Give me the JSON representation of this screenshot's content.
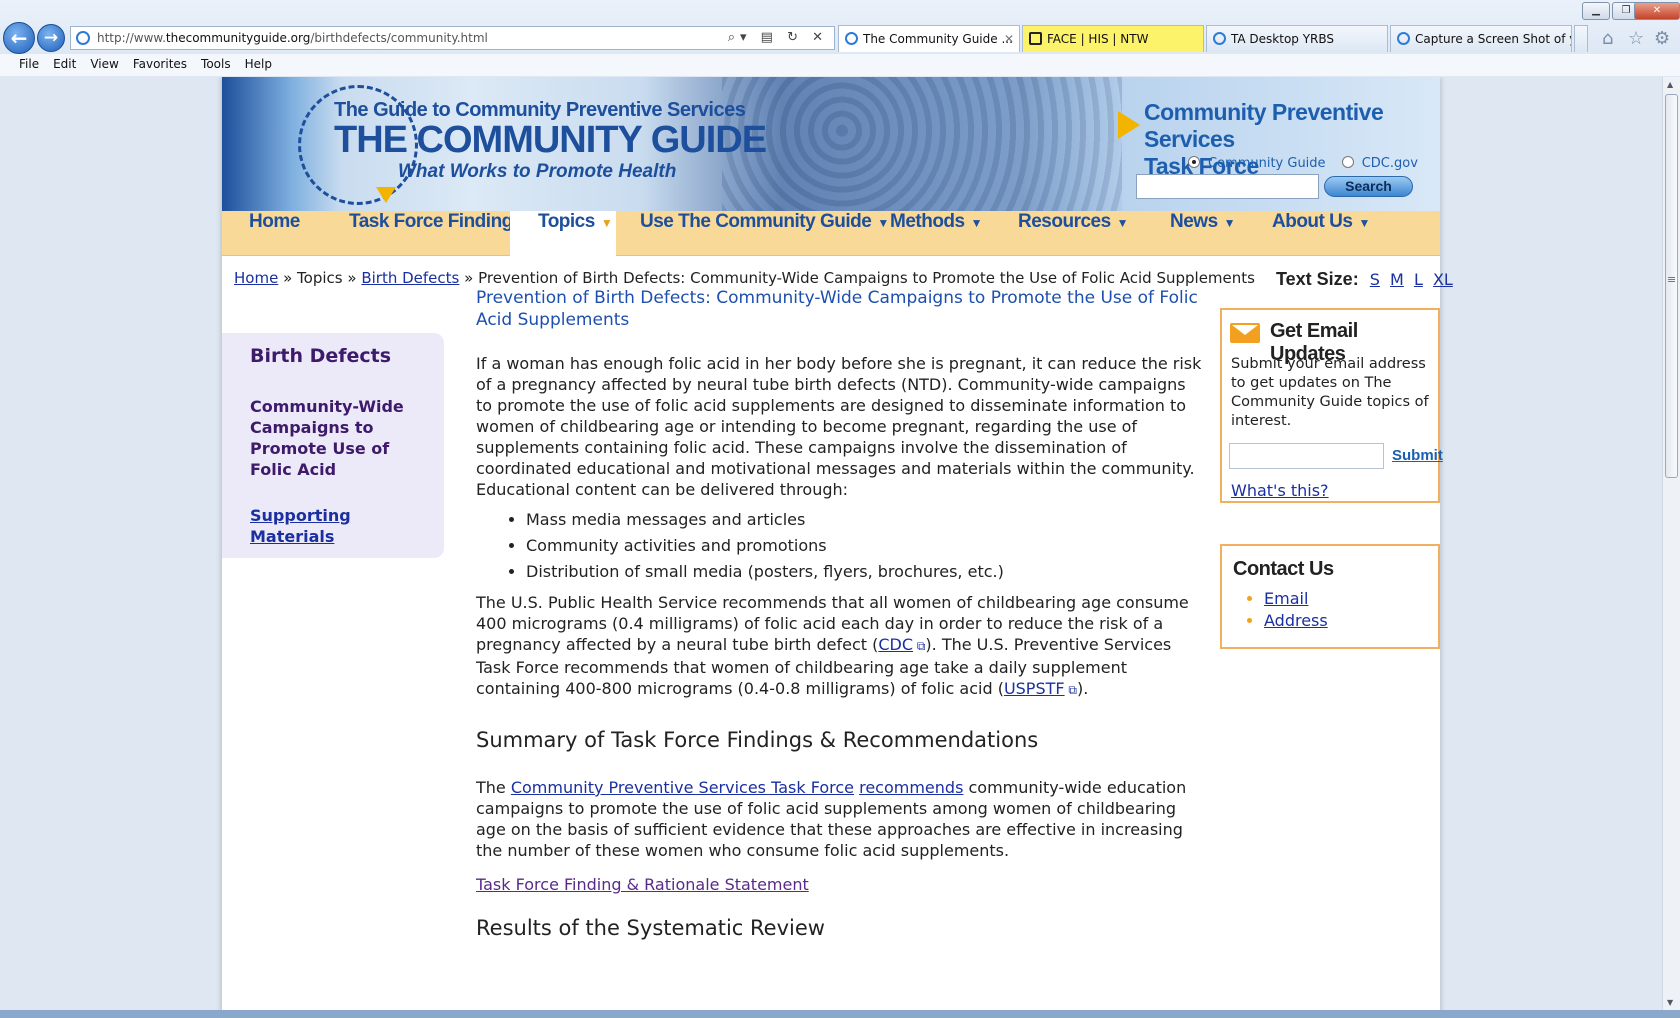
{
  "browser": {
    "address_prefix": "http://www.",
    "address_domain": "thecommunityguide.org",
    "address_path": "/birthdefects/community.html",
    "tabs": [
      {
        "label": "The Community Guide ..."
      },
      {
        "label": "FACE | HIS | NTW"
      },
      {
        "label": "TA Desktop YRBS"
      },
      {
        "label": "Capture a Screen Shot of y..."
      }
    ],
    "menu": [
      "File",
      "Edit",
      "View",
      "Favorites",
      "Tools",
      "Help"
    ]
  },
  "banner": {
    "logo_subtitle": "The Guide to Community Preventive Services",
    "logo_title": "THE COMMUNITY GUIDE",
    "logo_tagline": "What Works to Promote Health",
    "task_force_line1": "Community Preventive Services",
    "task_force_line2": "Task Force",
    "radio_community": "Community Guide",
    "radio_cdc": "CDC.gov",
    "search_button": "Search"
  },
  "nav": [
    {
      "label": "Home"
    },
    {
      "label": "Task Force Findings"
    },
    {
      "label": "Topics"
    },
    {
      "label": "Use The Community Guide"
    },
    {
      "label": "Methods"
    },
    {
      "label": "Resources"
    },
    {
      "label": "News"
    },
    {
      "label": "About Us"
    }
  ],
  "breadcrumb": {
    "home": "Home",
    "sep": "»",
    "topics": "Topics",
    "birth_defects": "Birth Defects",
    "current": "Prevention of Birth Defects: Community-Wide Campaigns to Promote the Use of Folic Acid Supplements"
  },
  "text_size": {
    "label": "Text Size:",
    "s": "S",
    "m": "M",
    "l": "L",
    "xl": "XL"
  },
  "sidebar": {
    "heading": "Birth Defects",
    "current": "Community-Wide Campaigns to Promote Use of Folic Acid",
    "link": "Supporting Materials"
  },
  "content": {
    "title": "Prevention of Birth Defects: Community-Wide Campaigns to Promote the Use of Folic Acid Supplements",
    "intro": "If a woman has enough folic acid in her body before she is pregnant, it can reduce the risk of a pregnancy affected by neural tube birth defects (NTD). Community-wide campaigns to promote the use of folic acid supplements are designed to disseminate information to women of childbearing age or intending to become pregnant, regarding the use of supplements containing folic acid. These campaigns involve the dissemination of coordinated educational and motivational messages and materials within the community. Educational content can be delivered through:",
    "bullets": [
      "Mass media messages and articles",
      "Community activities and promotions",
      "Distribution of small media (posters, flyers, brochures, etc.)"
    ],
    "usphs_1": "The U.S. Public Health Service recommends that all women of childbearing age consume 400 micrograms (0.4 milligrams) of folic acid each day in order to reduce the risk of a pregnancy affected by a neural tube birth defect (",
    "cdc_link": "CDC",
    "usphs_2": "). The U.S. Preventive Services Task Force recommends that women of childbearing age take a daily supplement containing 400-800 micrograms (0.4-0.8 milligrams) of folic acid (",
    "uspstf_link": "USPSTF",
    "usphs_3": ").",
    "summary_heading": "Summary of Task Force Findings & Recommendations",
    "summary_pre": "The ",
    "summary_link1": "Community Preventive Services Task Force",
    "summary_link2": "recommends",
    "summary_post": " community-wide education campaigns to promote the use of folic acid supplements among women of childbearing age on the basis of sufficient evidence that these approaches are effective in increasing the number of these women who consume folic acid supplements.",
    "rationale_link": "Task Force Finding & Rationale Statement",
    "results_heading": "Results of the Systematic Review"
  },
  "email_box": {
    "title": "Get Email Updates",
    "text": "Submit your email address to get updates on The Community Guide topics of interest.",
    "submit": "Submit",
    "whats_this": "What's this?"
  },
  "contact_box": {
    "title": "Contact Us",
    "email": "Email",
    "address": "Address"
  }
}
